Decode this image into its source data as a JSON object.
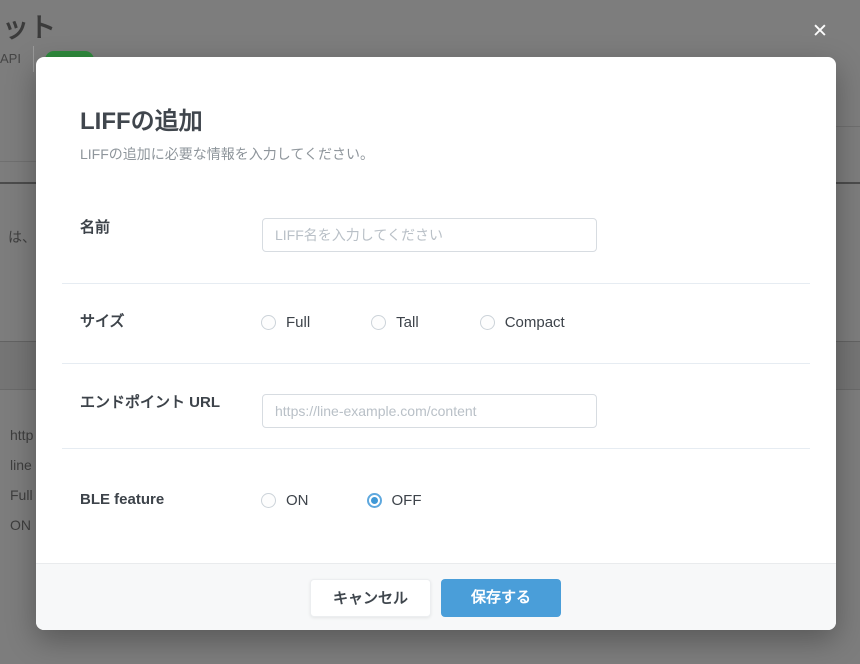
{
  "backdrop": {
    "page_title_fragment": "ット",
    "tab_api_label": "API",
    "text_fragments": {
      "f0": "は、",
      "f1": "http",
      "f2": "line",
      "f3": "Full",
      "f4": "ON"
    }
  },
  "overlay": {
    "close_icon": "✕"
  },
  "modal": {
    "title": "LIFFの追加",
    "subtitle": "LIFFの追加に必要な情報を入力してください。",
    "fields": {
      "name": {
        "label": "名前",
        "value": "",
        "placeholder": "LIFF名を入力してください"
      },
      "size": {
        "label": "サイズ",
        "options": {
          "full": "Full",
          "tall": "Tall",
          "compact": "Compact"
        },
        "selected": ""
      },
      "endpoint": {
        "label": "エンドポイント URL",
        "value": "",
        "placeholder": "https://line-example.com/content"
      },
      "ble": {
        "label": "BLE feature",
        "options": {
          "on": "ON",
          "off": "OFF"
        },
        "selected": "OFF"
      }
    },
    "footer": {
      "cancel_label": "キャンセル",
      "save_label": "保存する"
    }
  },
  "colors": {
    "accent_blue": "#4a9ed9",
    "badge_green": "#2f8a3d",
    "backdrop_gray": "#7d7d7d"
  }
}
